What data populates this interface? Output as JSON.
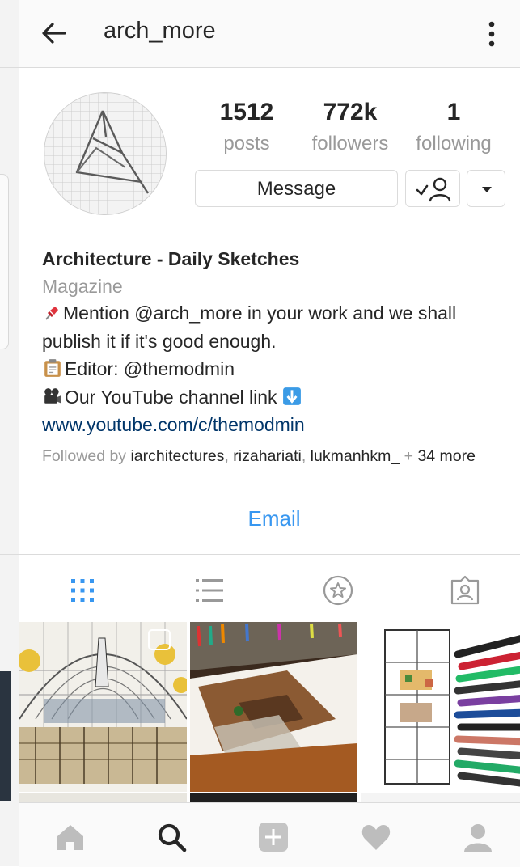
{
  "header": {
    "title": "arch_more"
  },
  "stats": [
    {
      "value": "1512",
      "label": "posts"
    },
    {
      "value": "772k",
      "label": "followers"
    },
    {
      "value": "1",
      "label": "following"
    }
  ],
  "actions": {
    "message_label": "Message"
  },
  "bio": {
    "name": "Architecture - Daily Sketches",
    "category": "Magazine",
    "line1": "Mention @arch_more in your work and we shall",
    "line2": "publish it if it's good enough.",
    "line3": "Editor: @themodmin",
    "line4": "Our YouTube channel link",
    "link": "www.youtube.com/c/themodmin",
    "followed_prefix": "Followed by ",
    "followers": [
      "iarchitectures",
      "rizahariati",
      "lukmanhkm_"
    ],
    "followed_more": "34 more"
  },
  "email_label": "Email",
  "colors": {
    "accent": "#3897f0",
    "link": "#003569",
    "muted": "#999999",
    "text": "#262626",
    "border": "#dbdbdb"
  },
  "icons": {
    "back": "arrow-left",
    "more": "vertical-dots",
    "following": "check-person",
    "dropdown": "caret-down",
    "tab_grid": "grid",
    "tab_list": "list",
    "tab_saved": "star-circle",
    "tab_tagged": "tagged-person",
    "nav_home": "home",
    "nav_search": "search",
    "nav_add": "plus-square",
    "nav_activity": "heart",
    "nav_profile": "person"
  }
}
